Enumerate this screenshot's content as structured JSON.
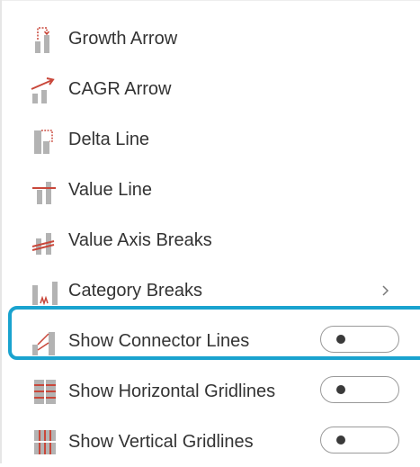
{
  "menu": {
    "items": [
      {
        "label": "Growth Arrow",
        "icon": "growth-arrow-icon"
      },
      {
        "label": "CAGR Arrow",
        "icon": "cagr-arrow-icon"
      },
      {
        "label": "Delta Line",
        "icon": "delta-line-icon"
      },
      {
        "label": "Value Line",
        "icon": "value-line-icon"
      },
      {
        "label": "Value Axis Breaks",
        "icon": "value-axis-breaks-icon"
      },
      {
        "label": "Category Breaks",
        "icon": "category-breaks-icon",
        "has_submenu": true
      },
      {
        "label": "Show Connector Lines",
        "icon": "connector-lines-icon",
        "toggle": "off",
        "highlighted": true
      },
      {
        "label": "Show Horizontal Gridlines",
        "icon": "horizontal-gridlines-icon",
        "toggle": "off"
      },
      {
        "label": "Show Vertical Gridlines",
        "icon": "vertical-gridlines-icon",
        "toggle": "off"
      }
    ]
  },
  "colors": {
    "accent_red": "#c9473a",
    "icon_gray": "#b3b3b3",
    "highlight": "#1aa3cf",
    "text": "#333333"
  }
}
